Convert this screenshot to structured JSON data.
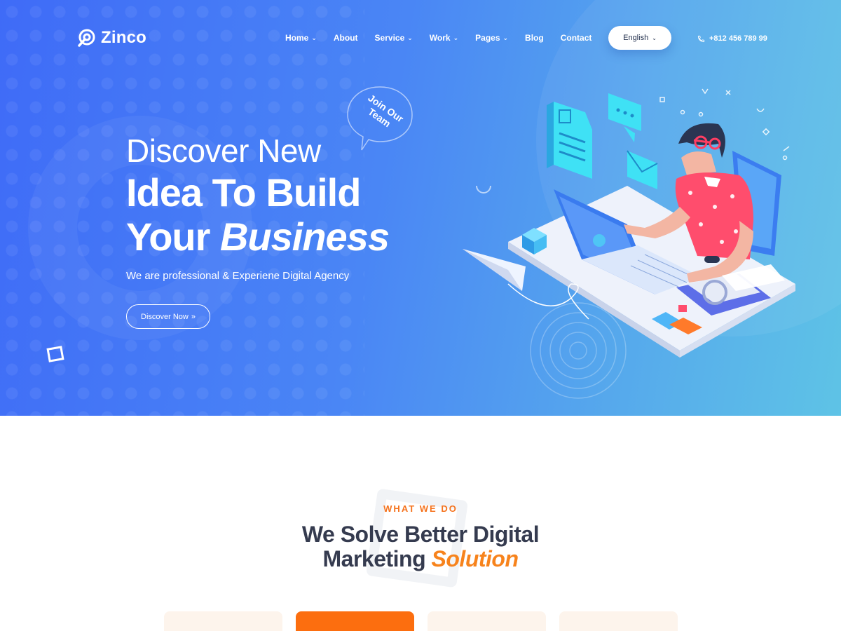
{
  "brand": {
    "name": "Zinco"
  },
  "nav": {
    "items": [
      {
        "label": "Home",
        "has_dropdown": true
      },
      {
        "label": "About",
        "has_dropdown": false
      },
      {
        "label": "Service",
        "has_dropdown": true
      },
      {
        "label": "Work",
        "has_dropdown": true
      },
      {
        "label": "Pages",
        "has_dropdown": true
      },
      {
        "label": "Blog",
        "has_dropdown": false
      },
      {
        "label": "Contact",
        "has_dropdown": false
      }
    ],
    "language": "English",
    "phone": "+812 456 789 99"
  },
  "hero": {
    "line1": "Discover New",
    "line2": "Idea To Build",
    "line3_plain": "Your",
    "line3_italic": "Business",
    "subtitle": "We are professional & Experiene Digital Agency",
    "cta_label": "Discover Now",
    "bubble_text": "Join Our Team"
  },
  "section": {
    "eyebrow": "WHAT WE DO",
    "title_line1": "We Solve Better Digital",
    "title_line2_plain": "Marketing",
    "title_line2_accent": "Solution"
  },
  "colors": {
    "hero_gradient_start": "#3f6bf7",
    "hero_gradient_end": "#5ec3e6",
    "accent_orange": "#f7831c",
    "heading_dark": "#353b4f"
  }
}
